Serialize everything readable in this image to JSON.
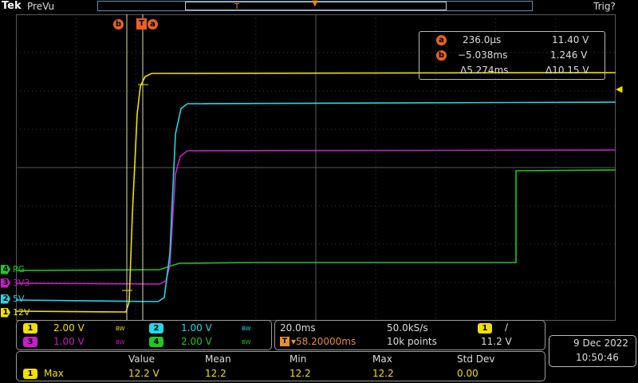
{
  "top": {
    "brand": "Tek",
    "mode": "PreVu",
    "trigger_status": "Trig?"
  },
  "cursor_markers": {
    "b": "b",
    "t": "T",
    "a": "a"
  },
  "cursors": {
    "a": {
      "label": "a",
      "time": "236.0µs",
      "value": "11.40 V"
    },
    "b": {
      "label": "b",
      "time": "−5.038ms",
      "value": "1.246 V"
    },
    "delta_time": "Δ5.274ms",
    "delta_value": "Δ10.15 V"
  },
  "channels": [
    {
      "num": "1",
      "name": "12V",
      "color": "#f0e000",
      "scale": "2.00 V"
    },
    {
      "num": "2",
      "name": "5V",
      "color": "#20d8e8",
      "scale": "1.00 V"
    },
    {
      "num": "3",
      "name": "3V3",
      "color": "#c81ec8",
      "scale": "1.00 V"
    },
    {
      "num": "4",
      "name": "PG",
      "color": "#20c820",
      "scale": "2.00 V"
    }
  ],
  "bw_label": "BW",
  "horizontal": {
    "time_div": "20.0ms",
    "sample_rate": "50.0kS/s",
    "position": "▾58.20000ms",
    "record": "10k points"
  },
  "trigger": {
    "channel": "1",
    "slope": "∕",
    "level": "11.2 V"
  },
  "datetime": {
    "date": "9 Dec  2022",
    "time": "10:50:46"
  },
  "measurement": {
    "headers": [
      "Value",
      "Mean",
      "Min",
      "Max",
      "Std Dev"
    ],
    "channel": "1",
    "name": "Max",
    "values": [
      "12.2 V",
      "12.2",
      "12.2",
      "12.2",
      "0.00"
    ]
  }
}
